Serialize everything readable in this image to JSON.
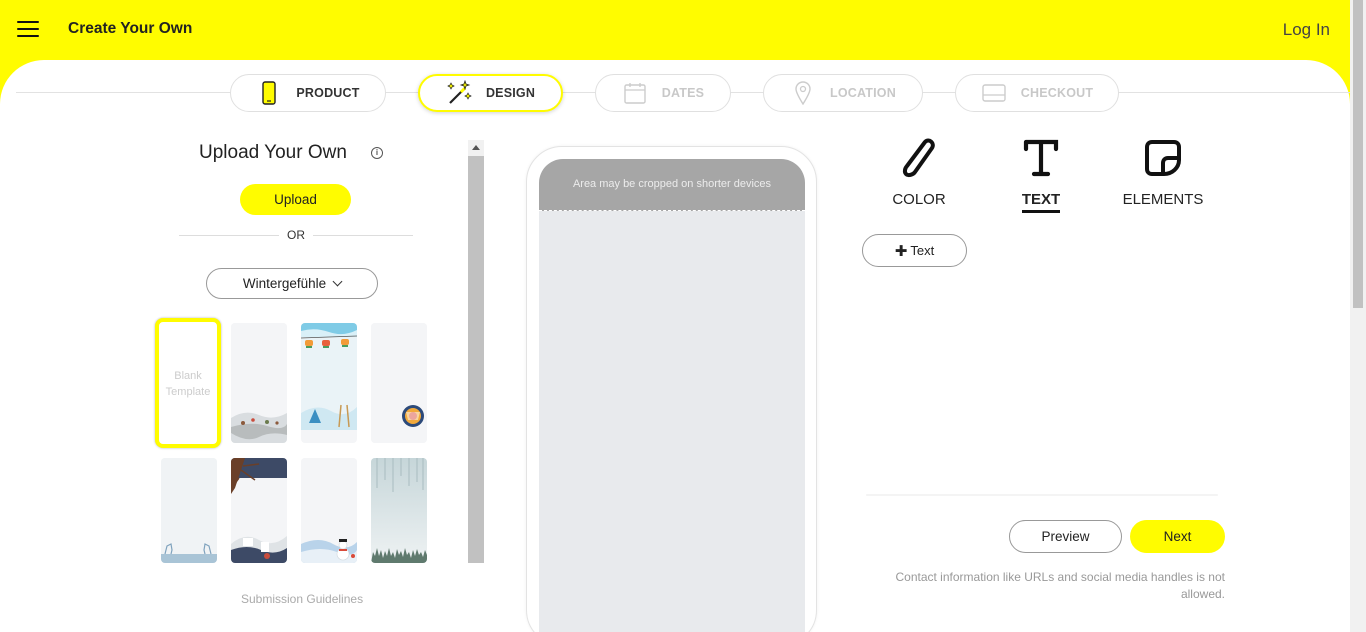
{
  "header": {
    "title": "Create Your Own",
    "login_label": "Log In"
  },
  "steps": [
    {
      "label": "PRODUCT",
      "icon": "phone-icon",
      "state": "done"
    },
    {
      "label": "DESIGN",
      "icon": "magic-wand-icon",
      "state": "active"
    },
    {
      "label": "DATES",
      "icon": "calendar-icon",
      "state": "disabled"
    },
    {
      "label": "LOCATION",
      "icon": "location-pin-icon",
      "state": "disabled"
    },
    {
      "label": "CHECKOUT",
      "icon": "card-icon",
      "state": "disabled"
    }
  ],
  "left_panel": {
    "title": "Upload Your Own",
    "info_icon": "i",
    "upload_label": "Upload",
    "or_label": "OR",
    "theme_selected": "Wintergefühle",
    "templates": [
      {
        "name": "blank",
        "label": "Blank Template",
        "selected": true
      },
      {
        "name": "winter-village",
        "selected": false
      },
      {
        "name": "ski-lift",
        "selected": false
      },
      {
        "name": "snow-badge",
        "selected": false
      },
      {
        "name": "reindeer",
        "selected": false
      },
      {
        "name": "winter-tree",
        "selected": false
      },
      {
        "name": "snowman",
        "selected": false
      },
      {
        "name": "snowy-forest",
        "selected": false
      }
    ],
    "guidelines_label": "Submission Guidelines"
  },
  "phone": {
    "crop_note": "Area may be cropped on shorter devices"
  },
  "tools": [
    {
      "label": "COLOR",
      "icon": "brush-icon",
      "active": false
    },
    {
      "label": "TEXT",
      "icon": "text-icon",
      "active": true
    },
    {
      "label": "ELEMENTS",
      "icon": "sticker-icon",
      "active": false
    }
  ],
  "right_panel": {
    "add_text_plus": "✚",
    "add_text_label": "Text",
    "preview_label": "Preview",
    "next_label": "Next",
    "contact_note": "Contact information like URLs and social media handles is not allowed."
  },
  "colors": {
    "brand_yellow": "#fffc00",
    "disabled_gray": "#c8c8c8"
  }
}
